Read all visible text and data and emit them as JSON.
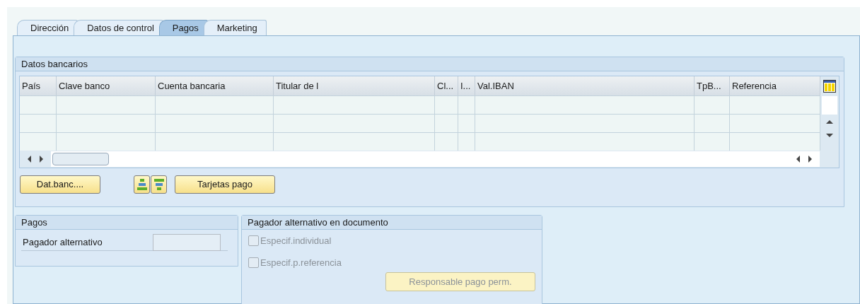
{
  "tabs": [
    {
      "label": "Dirección",
      "selected": false
    },
    {
      "label": "Datos de control",
      "selected": false
    },
    {
      "label": "Pagos",
      "selected": true
    },
    {
      "label": "Marketing",
      "selected": false
    }
  ],
  "bank_group": {
    "title": "Datos bancarios",
    "table": {
      "columns": [
        "País",
        "Clave banco",
        "Cuenta bancaria",
        "Titular de l",
        "Cl...",
        "I...",
        "Val.IBAN",
        "TpB...",
        "Referencia"
      ]
    },
    "buttons": [
      {
        "kind": "text",
        "label": "Dat.banc...."
      },
      {
        "kind": "icon-insert"
      },
      {
        "kind": "icon-delete"
      },
      {
        "kind": "text",
        "label": "Tarjetas pago"
      }
    ]
  },
  "payments_group": {
    "title": "Pagos",
    "field_label": "Pagador alternativo"
  },
  "alt_payer_group": {
    "title": "Pagador alternativo en documento",
    "checkboxes": [
      {
        "label": "Especif.individual",
        "checked": false,
        "disabled": true
      },
      {
        "label": "Especif.p.referencia",
        "checked": false,
        "disabled": true
      }
    ],
    "button": {
      "label": "Responsable pago perm.",
      "disabled": true
    }
  }
}
